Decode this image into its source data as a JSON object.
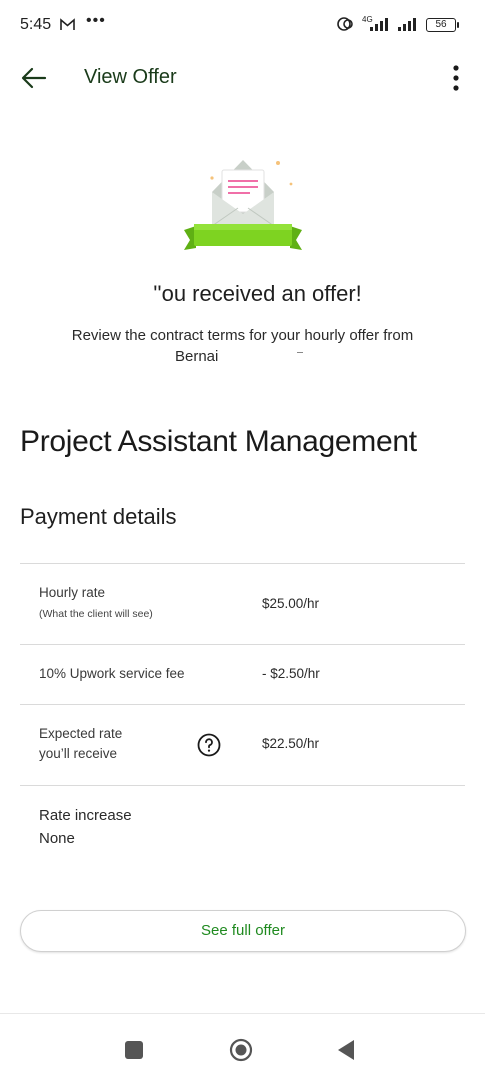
{
  "status_bar": {
    "time": "5:45",
    "network": "4G",
    "battery": "56"
  },
  "header": {
    "title": "View Offer"
  },
  "offer": {
    "heading": "''ou received an offer!",
    "subtitle": "Review the contract terms for your hourly offer from",
    "client": "Bernai"
  },
  "project": {
    "title": "Project Assistant Management"
  },
  "payment": {
    "title": "Payment details",
    "hourly_label": "Hourly rate",
    "hourly_hint": "(What the client will see)",
    "hourly_value": "$25.00/hr",
    "fee_label": "10% Upwork service fee",
    "fee_value": "- $2.50/hr",
    "expected_label_1": "Expected rate",
    "expected_label_2": "you’ll receive",
    "expected_value": "$22.50/hr",
    "increase_label": "Rate increase",
    "increase_value": "None"
  },
  "actions": {
    "full_offer": "See full offer"
  },
  "icons": {
    "back": "arrow-left-icon",
    "more": "more-vertical-icon",
    "help": "help-circle-icon",
    "mail": "gmail-icon",
    "link": "link-icon",
    "nav_recent": "square-icon",
    "nav_home": "circle-icon",
    "nav_back": "triangle-icon"
  },
  "colors": {
    "brand_green": "#1f8a1f",
    "title_green": "#1a3b1a",
    "ribbon_green": "#7ed321",
    "envelope_pink": "#f06fa8"
  }
}
